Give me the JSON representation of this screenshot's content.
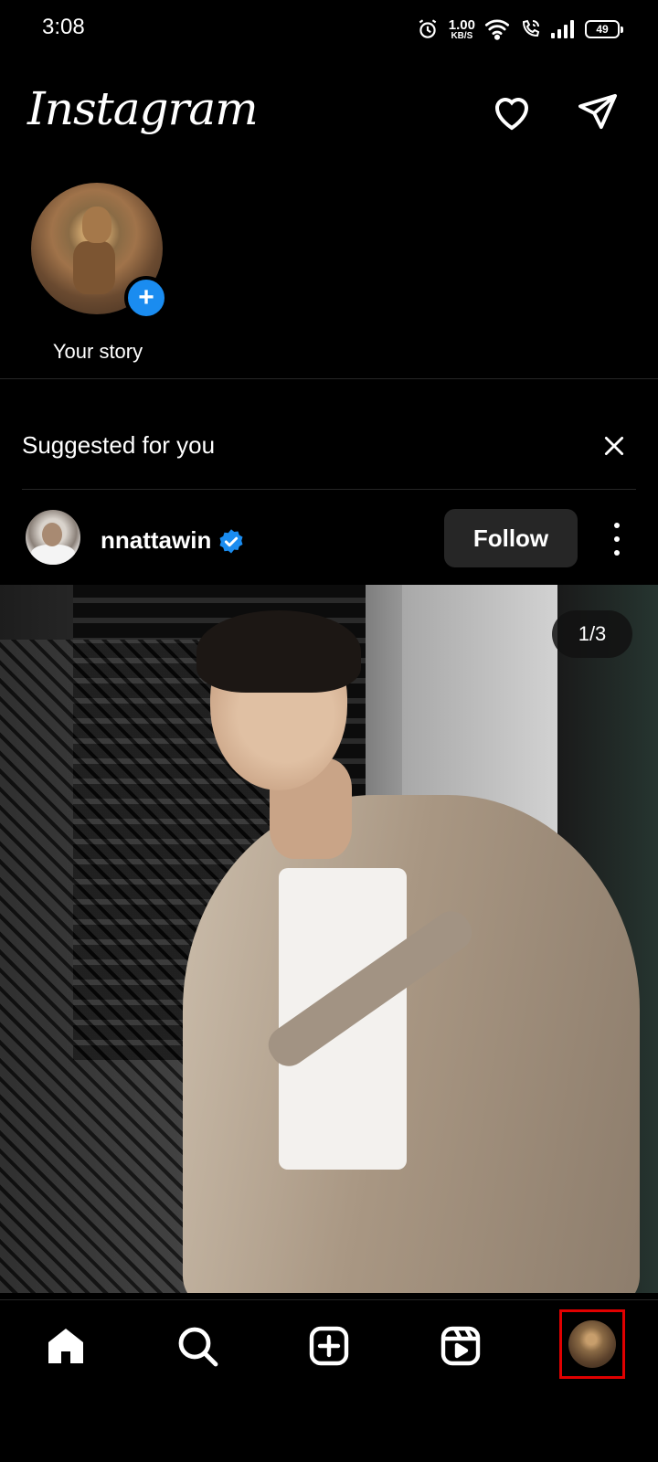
{
  "status_bar": {
    "time": "3:08",
    "net_speed_value": "1.00",
    "net_speed_unit": "KB/S",
    "battery": "49"
  },
  "header": {
    "logo": "Instagram",
    "icons": [
      "heart-icon",
      "direct-send-icon"
    ]
  },
  "stories": {
    "items": [
      {
        "label": "Your story"
      }
    ]
  },
  "suggested": {
    "title": "Suggested for you"
  },
  "post": {
    "username": "nnattawin",
    "verified": true,
    "follow_label": "Follow",
    "image_counter": "1/3"
  },
  "bottom_nav": {
    "items": [
      "home-icon",
      "search-icon",
      "create-icon",
      "reels-icon",
      "profile-avatar"
    ],
    "highlight_color": "#e00000"
  },
  "colors": {
    "accent_blue": "#1a8cf0",
    "background": "#000000",
    "button_gray": "#262626"
  }
}
